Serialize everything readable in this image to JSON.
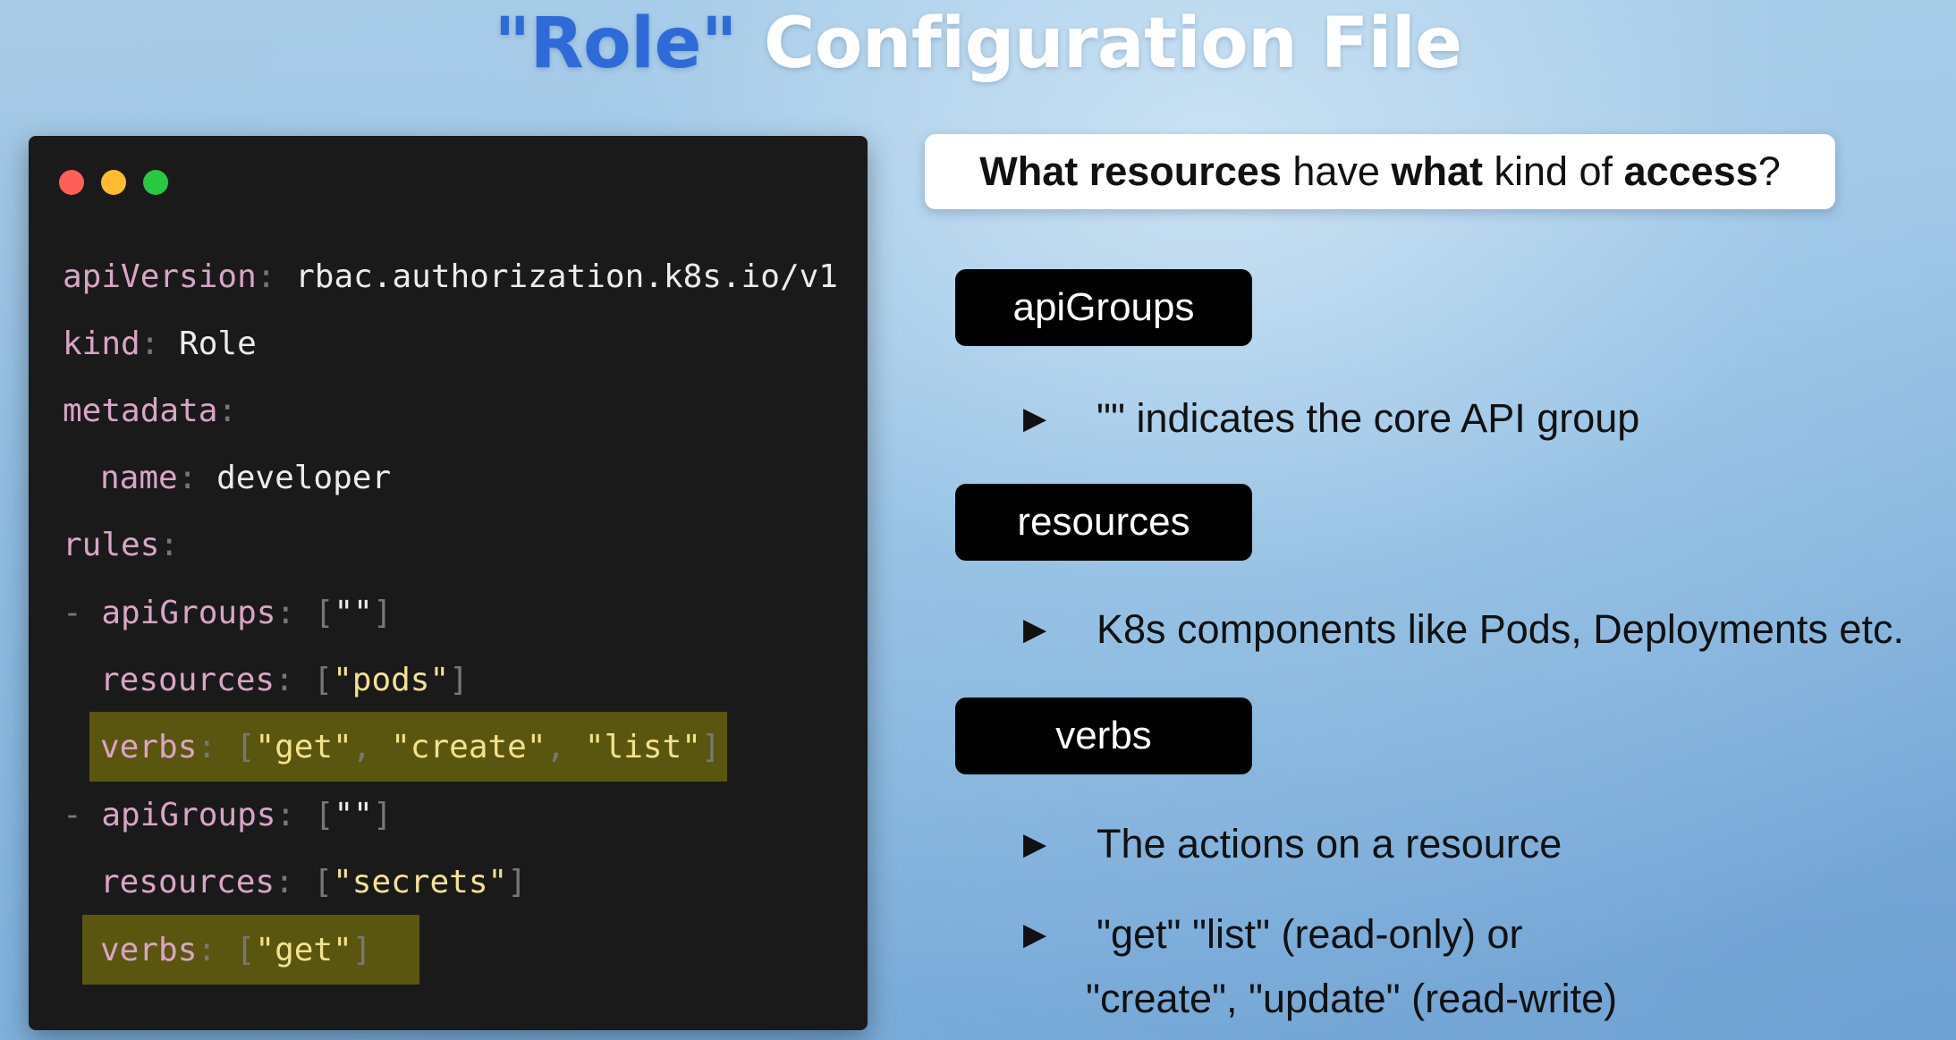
{
  "title": {
    "role_word": "\"Role\"",
    "rest": "Configuration File"
  },
  "code": {
    "lines": [
      {
        "key": "apiVersion",
        "value": "rbac.authorization.k8s.io/v1"
      },
      {
        "key": "kind",
        "value": "Role"
      },
      {
        "key": "metadata"
      },
      {
        "key": "name",
        "value": "developer"
      },
      {
        "key": "rules"
      },
      {
        "dash": "-",
        "key": "apiGroups",
        "items": [
          "\"\""
        ]
      },
      {
        "key": "resources",
        "items": [
          "\"pods\""
        ]
      },
      {
        "key": "verbs",
        "items": [
          "\"get\"",
          "\"create\"",
          "\"list\""
        ],
        "highlighted": true
      },
      {
        "dash": "-",
        "key": "apiGroups",
        "items": [
          "\"\""
        ]
      },
      {
        "key": "resources",
        "items": [
          "\"secrets\""
        ]
      },
      {
        "key": "verbs",
        "items": [
          "\"get\""
        ],
        "highlighted": true
      }
    ],
    "window_dots": [
      "#ff5f57",
      "#febc2e",
      "#28c840"
    ],
    "highlight_color": "#5b560f"
  },
  "question": {
    "b1": "What resources",
    "t1": " have ",
    "b2": "what",
    "t2": " kind of ",
    "b3": "access",
    "t3": "?"
  },
  "terms": [
    {
      "label": "apiGroups",
      "bullets": [
        "\"\" indicates the core API group"
      ]
    },
    {
      "label": "resources",
      "bullets": [
        "K8s components like Pods, Deployments etc."
      ]
    },
    {
      "label": "verbs",
      "bullets": [
        "The actions on a resource",
        "\"get\" \"list\" (read-only) or",
        "\"create\", \"update\" (read-write)"
      ]
    }
  ],
  "bullet_icon": "right-triangle-icon",
  "colors": {
    "title_accent": "#2f6bd8",
    "title_text": "#ffffff",
    "code_bg": "#1a1a1a",
    "code_key": "#d9a5c6",
    "code_string": "#f3e28e"
  }
}
